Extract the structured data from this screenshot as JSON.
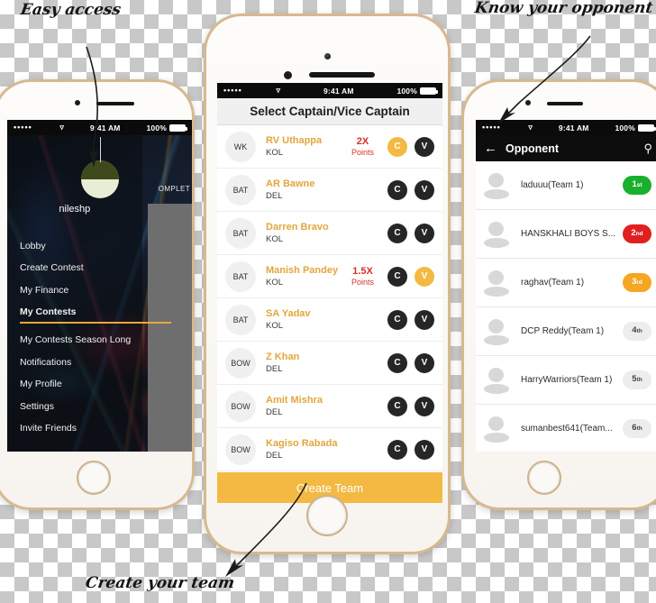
{
  "annotations": [
    {
      "id": "easy-access",
      "text": "Easy access"
    },
    {
      "id": "know-opponent",
      "text": "Know your opponent"
    },
    {
      "id": "create-team",
      "text": "Create your team"
    }
  ],
  "colors": {
    "accent_amber": "#f3b942",
    "player_name": "#e2a63c",
    "multiplier_red": "#d93025",
    "rank_1": "#19b02e",
    "rank_2": "#e02020",
    "rank_3": "#f5a623",
    "dark_badge": "#262626"
  },
  "status_bar": {
    "carrier_dots": "•••••",
    "wifi_icon": "wifi-icon",
    "time": "9:41 AM",
    "battery": "100%"
  },
  "left_phone": {
    "username": "nileshp",
    "peek_label": "OMPLET",
    "menu": [
      {
        "label": "Lobby",
        "active": false
      },
      {
        "label": "Create Contest",
        "active": false
      },
      {
        "label": "My Finance",
        "active": false
      },
      {
        "label": "My Contests",
        "active": true
      },
      {
        "label": "My Contests Season Long",
        "active": false
      },
      {
        "label": "Notifications",
        "active": false
      },
      {
        "label": "My Profile",
        "active": false
      },
      {
        "label": "Settings",
        "active": false
      },
      {
        "label": "Invite Friends",
        "active": false
      }
    ]
  },
  "center_phone": {
    "header_title": "Select Captain/Vice Captain",
    "captain_label": "C",
    "vice_captain_label": "V",
    "create_team_label": "Create Team",
    "players": [
      {
        "role": "WK",
        "name": "RV Uthappa",
        "team": "KOL",
        "multiplier_value": "2X",
        "multiplier_unit": "Points",
        "captain_selected": true,
        "vice_selected": false
      },
      {
        "role": "BAT",
        "name": "AR Bawne",
        "team": "DEL",
        "multiplier_value": "",
        "multiplier_unit": "",
        "captain_selected": false,
        "vice_selected": false
      },
      {
        "role": "BAT",
        "name": "Darren Bravo",
        "team": "KOL",
        "multiplier_value": "",
        "multiplier_unit": "",
        "captain_selected": false,
        "vice_selected": false
      },
      {
        "role": "BAT",
        "name": "Manish Pandey",
        "team": "KOL",
        "multiplier_value": "1.5X",
        "multiplier_unit": "Points",
        "captain_selected": false,
        "vice_selected": true
      },
      {
        "role": "BAT",
        "name": "SA Yadav",
        "team": "KOL",
        "multiplier_value": "",
        "multiplier_unit": "",
        "captain_selected": false,
        "vice_selected": false
      },
      {
        "role": "BOW",
        "name": "Z Khan",
        "team": "DEL",
        "multiplier_value": "",
        "multiplier_unit": "",
        "captain_selected": false,
        "vice_selected": false
      },
      {
        "role": "BOW",
        "name": "Amit Mishra",
        "team": "DEL",
        "multiplier_value": "",
        "multiplier_unit": "",
        "captain_selected": false,
        "vice_selected": false
      },
      {
        "role": "BOW",
        "name": "Kagiso Rabada",
        "team": "DEL",
        "multiplier_value": "",
        "multiplier_unit": "",
        "captain_selected": false,
        "vice_selected": false
      }
    ]
  },
  "right_phone": {
    "nav_title": "Opponent",
    "back_icon": "back-arrow-icon",
    "search_icon": "search-icon",
    "opponents": [
      {
        "name": "laduuu(Team 1)",
        "rank": "1",
        "rank_suffix": "st",
        "rank_style": "rank-1"
      },
      {
        "name": "HANSKHALI BOYS S...",
        "rank": "2",
        "rank_suffix": "nd",
        "rank_style": "rank-2"
      },
      {
        "name": "raghav(Team 1)",
        "rank": "3",
        "rank_suffix": "rd",
        "rank_style": "rank-3"
      },
      {
        "name": "DCP Reddy(Team 1)",
        "rank": "4",
        "rank_suffix": "th",
        "rank_style": "rank-n"
      },
      {
        "name": "HarryWarriors(Team 1)",
        "rank": "5",
        "rank_suffix": "th",
        "rank_style": "rank-n"
      },
      {
        "name": "sumanbest641(Team...",
        "rank": "6",
        "rank_suffix": "th",
        "rank_style": "rank-n"
      }
    ]
  }
}
